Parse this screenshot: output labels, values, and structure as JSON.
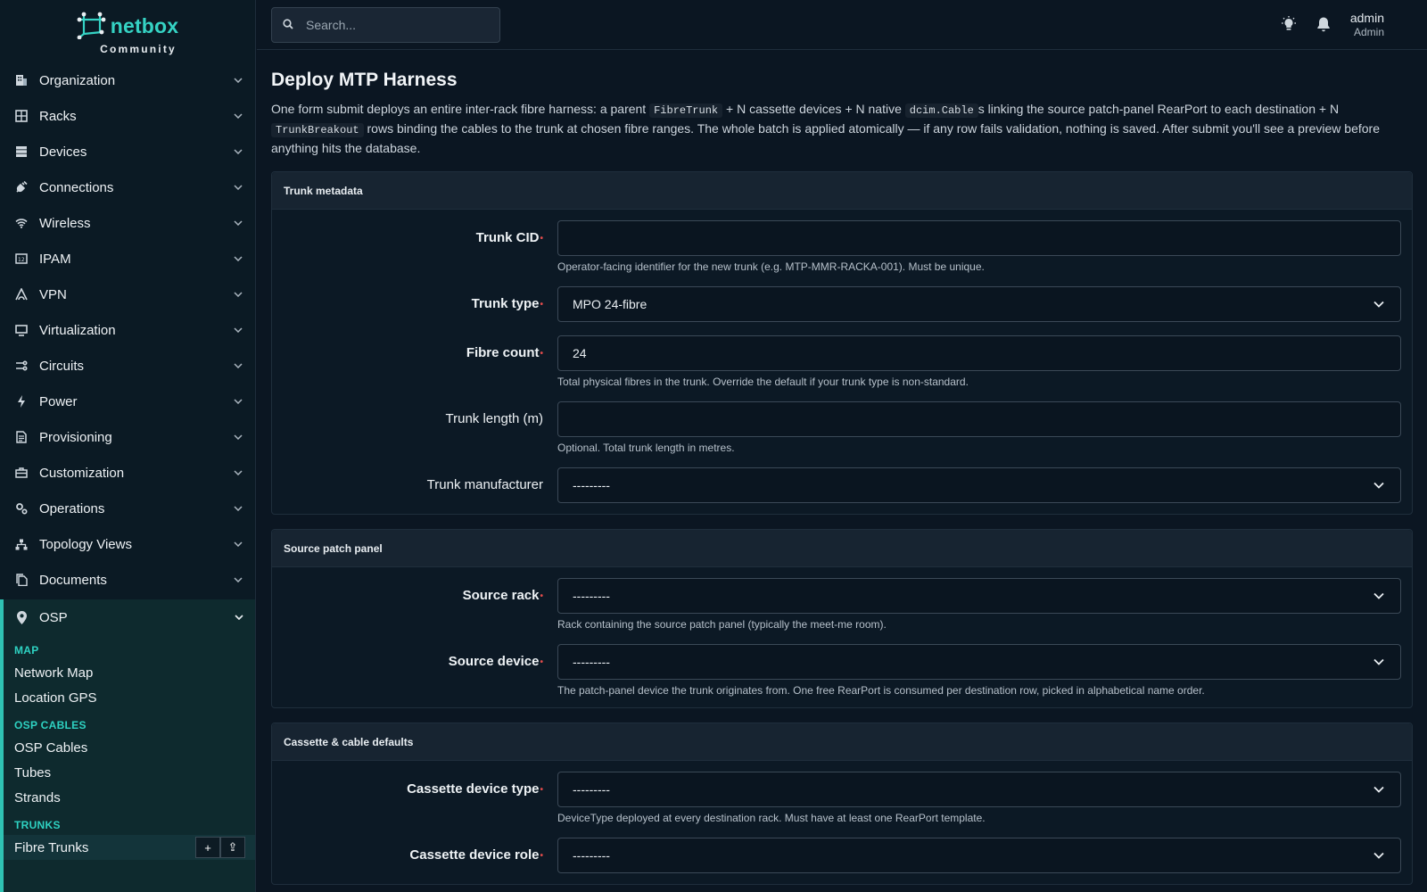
{
  "brand": {
    "name": "netbox",
    "edition": "Community"
  },
  "sidebar": {
    "items": [
      {
        "label": "Organization",
        "icon": "building-icon"
      },
      {
        "label": "Racks",
        "icon": "rack-icon"
      },
      {
        "label": "Devices",
        "icon": "server-icon"
      },
      {
        "label": "Connections",
        "icon": "plug-icon"
      },
      {
        "label": "Wireless",
        "icon": "wifi-icon"
      },
      {
        "label": "IPAM",
        "icon": "counter-icon"
      },
      {
        "label": "VPN",
        "icon": "tunnel-icon"
      },
      {
        "label": "Virtualization",
        "icon": "monitor-icon"
      },
      {
        "label": "Circuits",
        "icon": "transit-icon"
      },
      {
        "label": "Power",
        "icon": "lightning-icon"
      },
      {
        "label": "Provisioning",
        "icon": "file-document-icon"
      },
      {
        "label": "Customization",
        "icon": "toolbox-icon"
      },
      {
        "label": "Operations",
        "icon": "cogs-icon"
      },
      {
        "label": "Topology Views",
        "icon": "sitemap-icon"
      },
      {
        "label": "Documents",
        "icon": "file-multiple-icon"
      }
    ],
    "osp": {
      "label": "OSP",
      "icon": "map-marker-icon",
      "groups": [
        {
          "heading": "MAP",
          "items": [
            "Network Map",
            "Location GPS"
          ]
        },
        {
          "heading": "OSP CABLES",
          "items": [
            "OSP Cables",
            "Tubes",
            "Strands"
          ]
        },
        {
          "heading": "TRUNKS",
          "items": [
            "Fibre Trunks"
          ]
        }
      ],
      "active_item": "Fibre Trunks",
      "add_glyph": "+",
      "import_glyph": "⇪"
    }
  },
  "topbar": {
    "search_placeholder": "Search...",
    "user_name": "admin",
    "user_role": "Admin"
  },
  "page": {
    "title": "Deploy MTP Harness",
    "intro_1": "One form submit deploys an entire inter-rack fibre harness: a parent ",
    "code_1": "FibreTrunk",
    "intro_2": " + N cassette devices + N native ",
    "code_2": "dcim.Cable",
    "intro_3": "s linking the source patch-panel RearPort to each destination + N ",
    "code_3": "TrunkBreakout",
    "intro_4": " rows binding the cables to the trunk at chosen fibre ranges. The whole batch is applied atomically — if any row fails validation, nothing is saved. After submit you'll see a preview before anything hits the database."
  },
  "sections": {
    "trunk": {
      "title": "Trunk metadata",
      "cid_label": "Trunk CID",
      "cid_value": "",
      "cid_help": "Operator-facing identifier for the new trunk (e.g. MTP-MMR-RACKA-001). Must be unique.",
      "type_label": "Trunk type",
      "type_value": "MPO 24-fibre",
      "fibre_label": "Fibre count",
      "fibre_value": "24",
      "fibre_help": "Total physical fibres in the trunk. Override the default if your trunk type is non-standard.",
      "length_label": "Trunk length (m)",
      "length_value": "",
      "length_help": "Optional. Total trunk length in metres.",
      "mfr_label": "Trunk manufacturer",
      "mfr_value": "---------"
    },
    "source": {
      "title": "Source patch panel",
      "rack_label": "Source rack",
      "rack_value": "---------",
      "rack_help": "Rack containing the source patch panel (typically the meet-me room).",
      "device_label": "Source device",
      "device_value": "---------",
      "device_help": "The patch-panel device the trunk originates from. One free RearPort is consumed per destination row, picked in alphabetical name order."
    },
    "cassette": {
      "title": "Cassette & cable defaults",
      "type_label": "Cassette device type",
      "type_value": "---------",
      "type_help": "DeviceType deployed at every destination rack. Must have at least one RearPort template.",
      "role_label": "Cassette device role",
      "role_value": "---------"
    }
  },
  "required_mark": "•",
  "colors": {
    "accent": "#35d3c4",
    "required": "#e04b4b",
    "background": "#0b1622",
    "card_header": "#172431"
  }
}
